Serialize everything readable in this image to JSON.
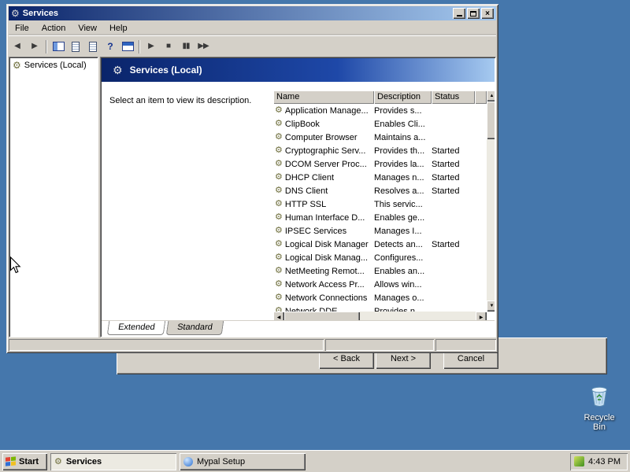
{
  "colors": {
    "desktop": "#4577AC",
    "titlebar_gradient_start": "#0A246A",
    "titlebar_gradient_end": "#A6CAF0",
    "chrome": "#D4D0C8",
    "content": "#FFFFFF"
  },
  "window": {
    "title": "Services",
    "menu": [
      "File",
      "Action",
      "View",
      "Help"
    ],
    "tree_root": "Services (Local)",
    "banner_title": "Services (Local)",
    "hint": "Select an item to view its description.",
    "columns": [
      "Name",
      "Description",
      "Status"
    ],
    "rows": [
      {
        "name": "Application Manage...",
        "description": "Provides s...",
        "status": ""
      },
      {
        "name": "ClipBook",
        "description": "Enables Cli...",
        "status": ""
      },
      {
        "name": "Computer Browser",
        "description": "Maintains a...",
        "status": ""
      },
      {
        "name": "Cryptographic Serv...",
        "description": "Provides th...",
        "status": "Started"
      },
      {
        "name": "DCOM Server Proc...",
        "description": "Provides la...",
        "status": "Started"
      },
      {
        "name": "DHCP Client",
        "description": "Manages n...",
        "status": "Started"
      },
      {
        "name": "DNS Client",
        "description": "Resolves a...",
        "status": "Started"
      },
      {
        "name": "HTTP SSL",
        "description": "This servic...",
        "status": ""
      },
      {
        "name": "Human Interface D...",
        "description": "Enables ge...",
        "status": ""
      },
      {
        "name": "IPSEC Services",
        "description": "Manages I...",
        "status": ""
      },
      {
        "name": "Logical Disk Manager",
        "description": "Detects an...",
        "status": "Started"
      },
      {
        "name": "Logical Disk Manag...",
        "description": "Configures...",
        "status": ""
      },
      {
        "name": "NetMeeting Remot...",
        "description": "Enables an...",
        "status": ""
      },
      {
        "name": "Network Access Pr...",
        "description": "Allows win...",
        "status": ""
      },
      {
        "name": "Network Connections",
        "description": "Manages o...",
        "status": ""
      },
      {
        "name": "Network DDE",
        "description": "Provides n...",
        "status": ""
      }
    ],
    "tabs": [
      "Extended",
      "Standard"
    ]
  },
  "icons": {
    "gear": "⚙",
    "back": "◀",
    "forward": "▶",
    "help": "?",
    "start": "▶",
    "stop": "■",
    "pause": "▮▮",
    "restart": "▶▶",
    "up": "▲",
    "down": "▼",
    "left": "◀",
    "right": "▶",
    "close": "×"
  },
  "dialog": {
    "back_label": "< Back",
    "next_label": "Next >",
    "cancel_label": "Cancel"
  },
  "desktop_icons": {
    "recycle_bin_label": "Recycle Bin"
  },
  "taskbar": {
    "start_label": "Start",
    "tasks": [
      {
        "label": "Services",
        "active": true
      },
      {
        "label": "Mypal Setup",
        "active": false
      }
    ],
    "tray_time": "4:43 PM"
  }
}
